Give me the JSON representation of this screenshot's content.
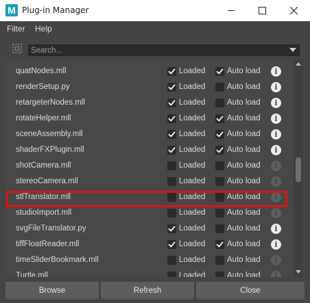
{
  "window": {
    "title": "Plug-in Manager",
    "app_icon_letter": "M"
  },
  "menu": [
    {
      "label": "Filter"
    },
    {
      "label": "Help"
    }
  ],
  "search": {
    "placeholder": "Search...",
    "value": ""
  },
  "columns": {
    "loaded_label": "Loaded",
    "autoload_label": "Auto load"
  },
  "plugins": [
    {
      "name": "quatNodes.mll",
      "loaded": true,
      "auto_load": true,
      "info_enabled": true
    },
    {
      "name": "renderSetup.py",
      "loaded": true,
      "auto_load": false,
      "info_enabled": true
    },
    {
      "name": "retargeterNodes.mll",
      "loaded": true,
      "auto_load": false,
      "info_enabled": true
    },
    {
      "name": "rotateHelper.mll",
      "loaded": true,
      "auto_load": true,
      "info_enabled": true
    },
    {
      "name": "sceneAssembly.mll",
      "loaded": true,
      "auto_load": true,
      "info_enabled": true
    },
    {
      "name": "shaderFXPlugin.mll",
      "loaded": true,
      "auto_load": true,
      "info_enabled": true
    },
    {
      "name": "shotCamera.mll",
      "loaded": false,
      "auto_load": false,
      "info_enabled": false
    },
    {
      "name": "stereoCamera.mll",
      "loaded": false,
      "auto_load": false,
      "info_enabled": false
    },
    {
      "name": "stlTranslator.mll",
      "loaded": false,
      "auto_load": false,
      "info_enabled": false,
      "highlighted": true
    },
    {
      "name": "studioImport.mll",
      "loaded": false,
      "auto_load": false,
      "info_enabled": false
    },
    {
      "name": "svgFileTranslator.py",
      "loaded": true,
      "auto_load": false,
      "info_enabled": true
    },
    {
      "name": "tiffFloatReader.mll",
      "loaded": true,
      "auto_load": true,
      "info_enabled": true
    },
    {
      "name": "timeSliderBookmark.mll",
      "loaded": false,
      "auto_load": false,
      "info_enabled": false
    },
    {
      "name": "Turtle.mll",
      "loaded": false,
      "auto_load": false,
      "info_enabled": false
    }
  ],
  "buttons": {
    "browse": "Browse",
    "refresh": "Refresh",
    "close": "Close"
  },
  "colors": {
    "highlight": "#d91414",
    "panel": "#444444",
    "app_icon": "#1a9fb5"
  },
  "icons": {
    "info": "info-icon",
    "checkmark": "checkmark-icon",
    "search_tool": "magic-lasso-icon"
  }
}
